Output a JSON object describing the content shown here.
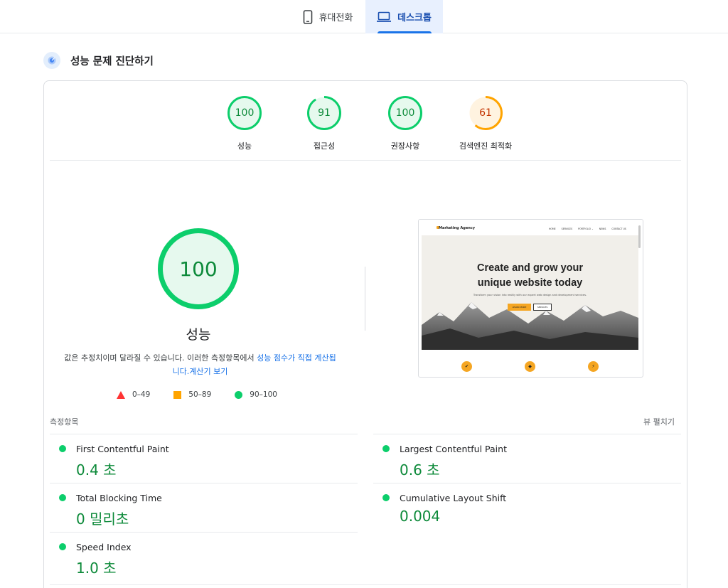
{
  "tabs": {
    "mobile_label": "휴대전화",
    "desktop_label": "데스크톱",
    "selected": "desktop"
  },
  "section": {
    "title": "성능 문제 진단하기"
  },
  "gauges": [
    {
      "score": "100",
      "label": "성능",
      "rating": "pass",
      "fraction": 1.0
    },
    {
      "score": "91",
      "label": "접근성",
      "rating": "pass",
      "fraction": 0.91
    },
    {
      "score": "100",
      "label": "권장사항",
      "rating": "pass",
      "fraction": 1.0
    },
    {
      "score": "61",
      "label": "검색엔진 최적화",
      "rating": "average",
      "fraction": 0.61
    }
  ],
  "performance": {
    "score": "100",
    "fraction": 1.0,
    "label": "성능",
    "description_text": "값은 추정치이며 달라질 수 있습니다. 이러한 측정항목에서 ",
    "description_link": "성능 점수가 직접 계산됩니다.",
    "calculator_link": "계산기 보기"
  },
  "legend": {
    "fail": "0–49",
    "average": "50–89",
    "pass": "90–100"
  },
  "screenshot": {
    "brand": "Marketing Agency",
    "menu": [
      "HOME",
      "SERVICES",
      "PORTFOLIO ⌄",
      "NEWS",
      "CONTACT US"
    ],
    "hero_title_line1": "Create and grow your",
    "hero_title_line2": "unique website today",
    "hero_subtitle": "Transform your vision into reality with our expert web design and development services.",
    "button_primary": "LEARN MORE",
    "button_secondary": "SERVICES"
  },
  "metrics": {
    "heading": "측정항목",
    "expand_label": "뷰 펼치기",
    "items": [
      {
        "name": "First Contentful Paint",
        "value": "0.4 초",
        "rating": "pass"
      },
      {
        "name": "Largest Contentful Paint",
        "value": "0.6 초",
        "rating": "pass"
      },
      {
        "name": "Total Blocking Time",
        "value": "0 밀리초",
        "rating": "pass"
      },
      {
        "name": "Cumulative Layout Shift",
        "value": "0.004",
        "rating": "pass"
      },
      {
        "name": "Speed Index",
        "value": "1.0 초",
        "rating": "pass"
      }
    ]
  },
  "colors": {
    "pass": "#0cce6b",
    "pass_text": "#0d8a3a",
    "average": "#ffa400",
    "average_text": "#c33300",
    "fail": "#ff3333",
    "accent": "#1a73e8"
  }
}
